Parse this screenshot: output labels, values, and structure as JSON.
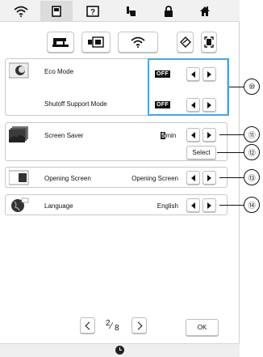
{
  "top_categories": [
    {
      "icon": "wifi-icon"
    },
    {
      "icon": "document-icon"
    },
    {
      "icon": "help-icon"
    },
    {
      "icon": "presser-foot-icon"
    },
    {
      "icon": "lock-icon"
    },
    {
      "icon": "home-icon"
    }
  ],
  "sub_buttons": [
    {
      "icon": "machine-settings-icon"
    },
    {
      "icon": "embroidery-settings-icon"
    },
    {
      "icon": "wireless-settings-icon"
    },
    {
      "icon": "sewing-guide-icon"
    },
    {
      "icon": "frame-icon"
    }
  ],
  "settings": {
    "eco_mode": {
      "label": "Eco Mode",
      "value": "OFF"
    },
    "shutoff_support": {
      "label": "Shutoff Support Mode",
      "value": "OFF"
    },
    "screen_saver": {
      "label": "Screen Saver",
      "value_number": "5",
      "value_unit": "min",
      "select_label": "Select"
    },
    "opening_screen": {
      "label": "Opening Screen",
      "value": "Opening Screen"
    },
    "language": {
      "label": "Language",
      "value": "English"
    }
  },
  "callouts": [
    "⑩",
    "⑪",
    "⑫",
    "⑬",
    "⑭"
  ],
  "pager": {
    "current": "2",
    "total": "8"
  },
  "ok_label": "OK",
  "colors": {
    "highlight": "#4aa6e0"
  }
}
